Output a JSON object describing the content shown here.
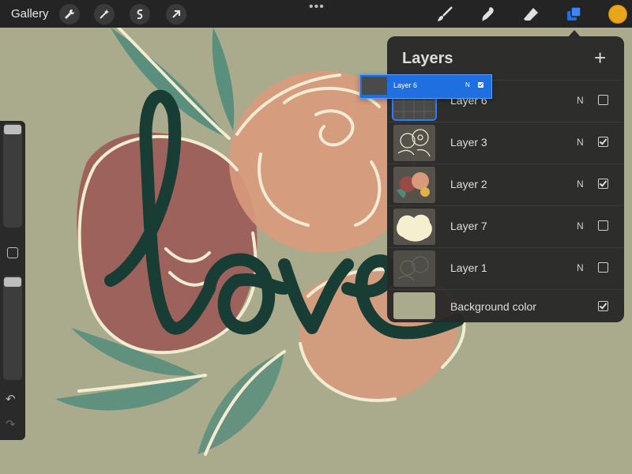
{
  "toolbar": {
    "gallery_label": "Gallery",
    "left_tools": [
      {
        "icon": "wrench-icon"
      },
      {
        "icon": "magic-wand-icon"
      },
      {
        "icon": "selection-icon"
      },
      {
        "icon": "transform-arrow-icon"
      }
    ],
    "more_label": "•••",
    "right_tools": [
      {
        "icon": "brush-icon"
      },
      {
        "icon": "smudge-icon"
      },
      {
        "icon": "eraser-icon"
      },
      {
        "icon": "layers-icon",
        "active": true
      }
    ],
    "current_color": "#e9a61c"
  },
  "layers_panel": {
    "title": "Layers",
    "add_label": "+",
    "layers": [
      {
        "name": "Layer 6",
        "mode": "N",
        "visible": false,
        "selected": true
      },
      {
        "name": "Layer 3",
        "mode": "N",
        "visible": true,
        "selected": false
      },
      {
        "name": "Layer 2",
        "mode": "N",
        "visible": true,
        "selected": false
      },
      {
        "name": "Layer 7",
        "mode": "N",
        "visible": false,
        "selected": false
      },
      {
        "name": "Layer 1",
        "mode": "N",
        "visible": false,
        "selected": false
      }
    ],
    "background": {
      "name": "Background color",
      "visible": true,
      "color": "#a9ab8c"
    }
  },
  "dragged_layer": {
    "name": "Layer 6",
    "mode": "N",
    "visible": true
  },
  "colors": {
    "accent": "#1f6fe0",
    "canvas_bg": "#a9ab8c",
    "lettering": "#183d35"
  }
}
